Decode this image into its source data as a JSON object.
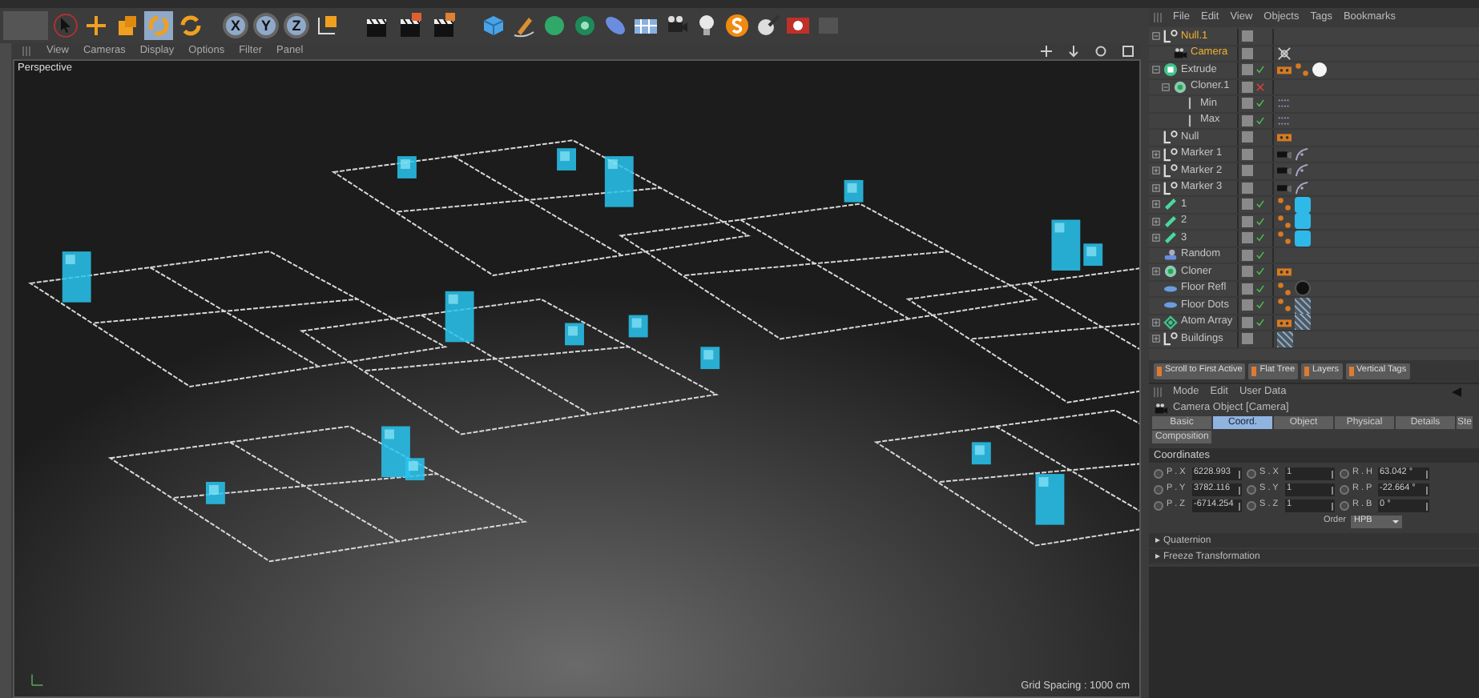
{
  "toolbar": {
    "axis_buttons": [
      {
        "label": "X",
        "selected": true
      },
      {
        "label": "Y",
        "selected": true
      },
      {
        "label": "Z",
        "selected": true
      }
    ]
  },
  "viewport": {
    "menu": [
      "View",
      "Cameras",
      "Display",
      "Options",
      "Filter",
      "Panel"
    ],
    "camera_label": "Perspective",
    "grid_spacing": "Grid Spacing : 1000 cm"
  },
  "object_manager": {
    "menu": [
      "File",
      "Edit",
      "View",
      "Objects",
      "Tags",
      "Bookmarks"
    ],
    "objects": [
      {
        "name": "Null.1",
        "kind": "null",
        "selected": true,
        "expanded": true,
        "children": [
          {
            "name": "Camera",
            "kind": "camera",
            "selected": true,
            "tags": [
              {
                "kind": "target"
              }
            ]
          }
        ]
      },
      {
        "name": "Extrude",
        "kind": "extrude",
        "selected": false,
        "expanded": true,
        "enabled": true,
        "tags": [
          {
            "kind": "phong"
          },
          {
            "kind": "dots"
          },
          {
            "kind": "material-white"
          }
        ],
        "children": [
          {
            "name": "Cloner.1",
            "kind": "cloner",
            "selected": false,
            "expanded": true,
            "enabled": false,
            "children": [
              {
                "name": "Min",
                "kind": "spline",
                "selected": false,
                "enabled": true,
                "tags": [
                  {
                    "kind": "points"
                  }
                ]
              },
              {
                "name": "Max",
                "kind": "spline",
                "selected": false,
                "enabled": true,
                "tags": [
                  {
                    "kind": "points"
                  }
                ]
              }
            ]
          }
        ]
      },
      {
        "name": "Null",
        "kind": "null",
        "selected": false,
        "tags": [
          {
            "kind": "phong"
          }
        ]
      },
      {
        "name": "Marker 1",
        "kind": "null",
        "selected": false,
        "expanded": false,
        "tags": [
          {
            "kind": "camera-tag"
          },
          {
            "kind": "curve"
          }
        ]
      },
      {
        "name": "Marker 2",
        "kind": "null",
        "selected": false,
        "expanded": false,
        "tags": [
          {
            "kind": "camera-tag"
          },
          {
            "kind": "curve"
          }
        ]
      },
      {
        "name": "Marker 3",
        "kind": "null",
        "selected": false,
        "expanded": false,
        "tags": [
          {
            "kind": "camera-tag"
          },
          {
            "kind": "curve"
          }
        ]
      },
      {
        "name": "1",
        "kind": "instance",
        "selected": false,
        "expanded": false,
        "enabled": true,
        "tags": [
          {
            "kind": "dots"
          },
          {
            "kind": "material-cyan"
          }
        ]
      },
      {
        "name": "2",
        "kind": "instance",
        "selected": false,
        "expanded": false,
        "enabled": true,
        "tags": [
          {
            "kind": "dots"
          },
          {
            "kind": "material-cyan"
          }
        ]
      },
      {
        "name": "3",
        "kind": "instance",
        "selected": false,
        "expanded": false,
        "enabled": true,
        "tags": [
          {
            "kind": "dots"
          },
          {
            "kind": "material-cyan"
          }
        ]
      },
      {
        "name": "Random",
        "kind": "random",
        "selected": false,
        "enabled": true
      },
      {
        "name": "Cloner",
        "kind": "cloner",
        "selected": false,
        "expanded": false,
        "enabled": true,
        "tags": [
          {
            "kind": "phong"
          }
        ]
      },
      {
        "name": "Floor Refl",
        "kind": "plane",
        "selected": false,
        "enabled": true,
        "tags": [
          {
            "kind": "dots"
          },
          {
            "kind": "material-black"
          }
        ]
      },
      {
        "name": "Floor Dots",
        "kind": "plane",
        "selected": false,
        "enabled": true,
        "tags": [
          {
            "kind": "dots"
          },
          {
            "kind": "material-hatched"
          }
        ]
      },
      {
        "name": "Atom Array",
        "kind": "array",
        "selected": false,
        "expanded": false,
        "enabled": true,
        "tags": [
          {
            "kind": "phong"
          },
          {
            "kind": "material-hatched"
          }
        ]
      },
      {
        "name": "Buildings",
        "kind": "null",
        "selected": false,
        "expanded": false,
        "tags": [
          {
            "kind": "material-hatched"
          }
        ]
      }
    ],
    "buttons": [
      "Scroll to First Active",
      "Flat Tree",
      "Layers",
      "Vertical Tags"
    ]
  },
  "attribute_manager": {
    "menu": [
      "Mode",
      "Edit",
      "User Data"
    ],
    "title": "Camera Object [Camera]",
    "tabs": [
      {
        "label": "Basic",
        "selected": false
      },
      {
        "label": "Coord.",
        "selected": true
      },
      {
        "label": "Object",
        "selected": false
      },
      {
        "label": "Physical",
        "selected": false
      },
      {
        "label": "Details",
        "selected": false
      },
      {
        "label": "Ste",
        "selected": false
      },
      {
        "label": "Composition",
        "selected": false
      }
    ],
    "section": "Coordinates",
    "rows": [
      [
        {
          "label": "P . X",
          "value": "6228.993"
        },
        {
          "label": "S . X",
          "value": "1"
        },
        {
          "label": "R . H",
          "value": "63.042 °"
        }
      ],
      [
        {
          "label": "P . Y",
          "value": "3782.116"
        },
        {
          "label": "S . Y",
          "value": "1"
        },
        {
          "label": "R . P",
          "value": "-22.664 °"
        }
      ],
      [
        {
          "label": "P . Z",
          "value": "-6714.254"
        },
        {
          "label": "S . Z",
          "value": "1"
        },
        {
          "label": "R . B",
          "value": "0 °"
        }
      ]
    ],
    "order_label": "Order",
    "order_value": "HPB",
    "groups": [
      "Quaternion",
      "Freeze Transformation"
    ]
  }
}
